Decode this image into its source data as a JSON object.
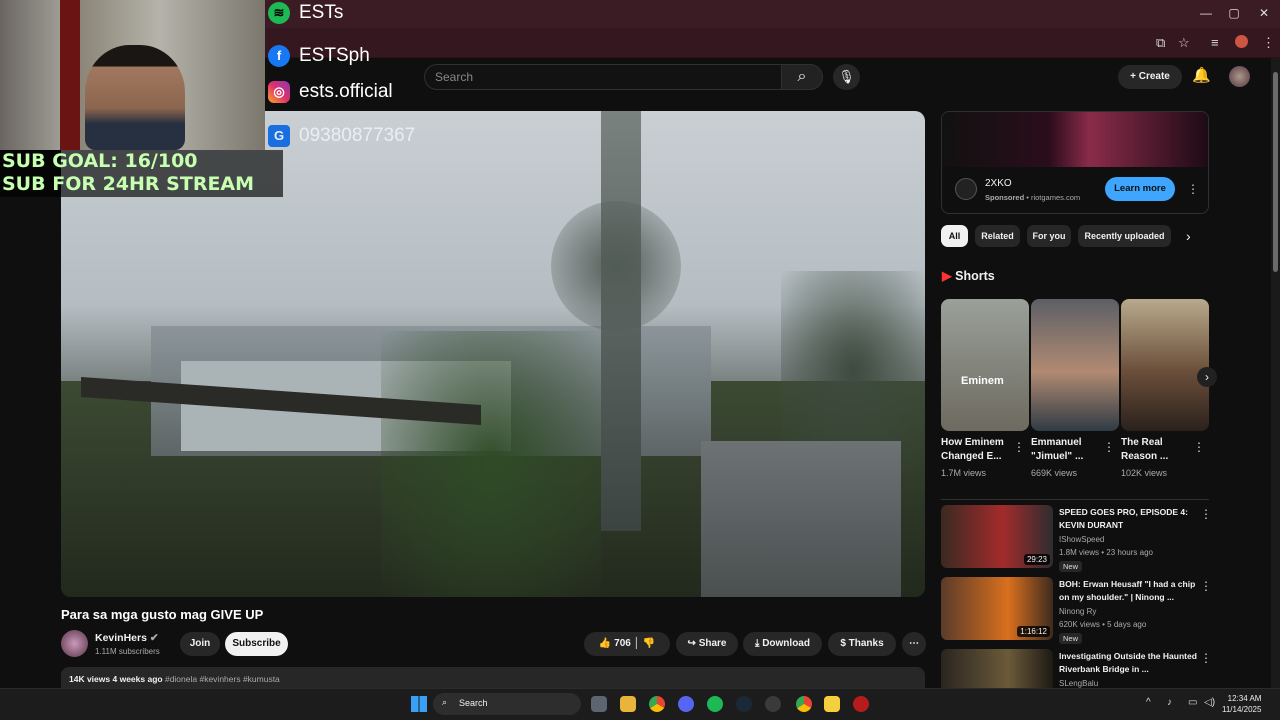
{
  "browser": {
    "window_controls": [
      "—",
      "▢",
      "✕"
    ]
  },
  "header": {
    "search_placeholder": "Search",
    "create_label": "Create"
  },
  "video": {
    "title": "Para sa mga gusto mag GIVE UP",
    "channel": "KevinHers",
    "subscribers": "1.11M subscribers",
    "join_label": "Join",
    "subscribe_label": "Subscribe",
    "likes": "706",
    "share_label": "Share",
    "download_label": "Download",
    "thanks_label": "Thanks",
    "views": "14K views",
    "age": "4 weeks ago",
    "hashtags": "#dionela #kevinhers #kumusta"
  },
  "ad": {
    "name": "2XKO",
    "sponsored": "Sponsored",
    "domain": "riotgames.com",
    "cta": "Learn more"
  },
  "chips": [
    "All",
    "Related",
    "For you",
    "Recently uploaded"
  ],
  "shorts": {
    "heading": "Shorts",
    "items": [
      {
        "title": "How Eminem Changed E...",
        "views": "1.7M views",
        "overlay": "Eminem"
      },
      {
        "title": "Emmanuel \"Jimuel\" ...",
        "views": "669K views"
      },
      {
        "title": "The Real Reason ...",
        "views": "102K views"
      }
    ]
  },
  "videos": [
    {
      "title": "SPEED GOES PRO, EPISODE 4: KEVIN DURANT",
      "channel": "IShowSpeed",
      "meta": "1.8M views • 23 hours ago",
      "badge": "New",
      "duration": "29:23"
    },
    {
      "title": "BOH: Erwan Heusaff \"I had a chip on my shoulder.\" | Ninong ...",
      "channel": "Ninong Ry",
      "meta": "620K views • 5 days ago",
      "badge": "New",
      "duration": "1:16:12"
    },
    {
      "title": "Investigating Outside the Haunted Riverbank Bridge in ...",
      "channel": "SLengBalu",
      "meta": ""
    }
  ],
  "overlay": {
    "socials": [
      {
        "icon": "spotify-icon",
        "text": "ESTs"
      },
      {
        "icon": "facebook-icon",
        "text": "ESTSph"
      },
      {
        "icon": "instagram-icon",
        "text": "ests.official"
      },
      {
        "icon": "gcash-icon",
        "text": "09380877367"
      }
    ],
    "sub_goal": "SUB GOAL: 16/100",
    "sub_stream": "SUB FOR 24HR STREAM"
  },
  "taskbar": {
    "search_label": "Search",
    "time": "12:34 AM",
    "date": "11/14/2025"
  },
  "colors": {
    "accent": "#3ea6ff",
    "overlay_green": "#c6ffb0",
    "titlebar": "#3b1c24"
  }
}
